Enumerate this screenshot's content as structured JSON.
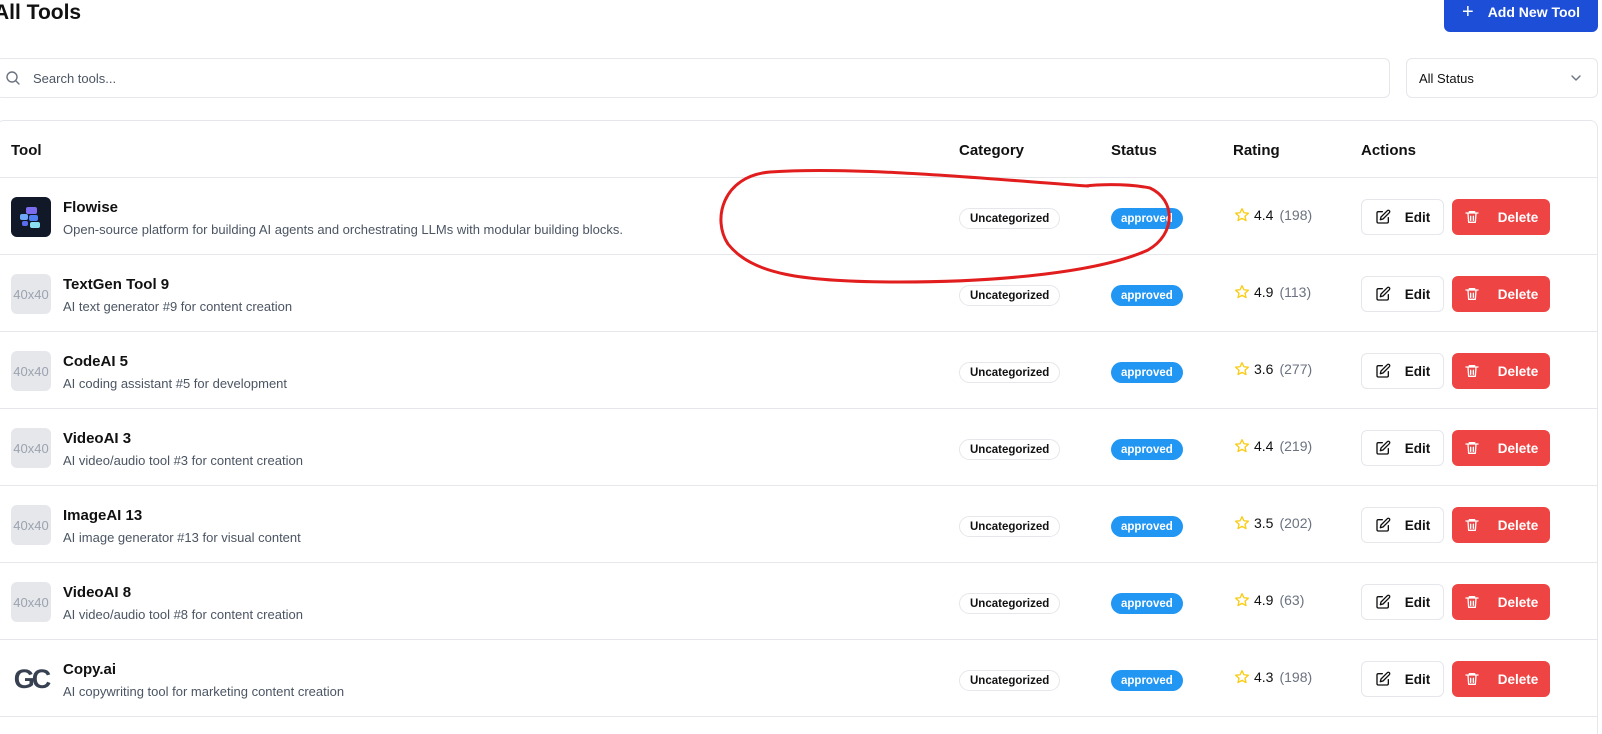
{
  "header": {
    "title": "All Tools",
    "add_button_label": "Add New Tool"
  },
  "filters": {
    "search_placeholder": "Search tools...",
    "status_selected": "All Status"
  },
  "table": {
    "columns": [
      "Tool",
      "Category",
      "Status",
      "Rating",
      "Actions"
    ],
    "edit_label": "Edit",
    "delete_label": "Delete",
    "rows": [
      {
        "name": "Flowise",
        "description": "Open-source platform for building AI agents and orchestrating LLMs with modular building blocks.",
        "logo": "flowise-logo",
        "logo_text": "",
        "category": "Uncategorized",
        "status": "approved",
        "rating": "4.4",
        "reviews": "(198)"
      },
      {
        "name": "TextGen Tool 9",
        "description": "AI text generator #9 for content creation",
        "logo": "placeholder",
        "logo_text": "40x40",
        "category": "Uncategorized",
        "status": "approved",
        "rating": "4.9",
        "reviews": "(113)"
      },
      {
        "name": "CodeAI 5",
        "description": "AI coding assistant #5 for development",
        "logo": "placeholder",
        "logo_text": "40x40",
        "category": "Uncategorized",
        "status": "approved",
        "rating": "3.6",
        "reviews": "(277)"
      },
      {
        "name": "VideoAI 3",
        "description": "AI video/audio tool #3 for content creation",
        "logo": "placeholder",
        "logo_text": "40x40",
        "category": "Uncategorized",
        "status": "approved",
        "rating": "4.4",
        "reviews": "(219)"
      },
      {
        "name": "ImageAI 13",
        "description": "AI image generator #13 for visual content",
        "logo": "placeholder",
        "logo_text": "40x40",
        "category": "Uncategorized",
        "status": "approved",
        "rating": "3.5",
        "reviews": "(202)"
      },
      {
        "name": "VideoAI 8",
        "description": "AI video/audio tool #8 for content creation",
        "logo": "placeholder",
        "logo_text": "40x40",
        "category": "Uncategorized",
        "status": "approved",
        "rating": "4.9",
        "reviews": "(63)"
      },
      {
        "name": "Copy.ai",
        "description": "AI copywriting tool for marketing content creation",
        "logo": "copyai-logo",
        "logo_text": "GC",
        "category": "Uncategorized",
        "status": "approved",
        "rating": "4.3",
        "reviews": "(198)"
      }
    ]
  },
  "colors": {
    "primary": "#1d4ed8",
    "danger": "#ef4444",
    "status_approved": "#2196f3",
    "star": "#facc15",
    "annotation": "#e11d1d"
  },
  "annotation": {
    "shape": "red-hand-drawn-circle",
    "target": "flowise-row-status-area"
  }
}
